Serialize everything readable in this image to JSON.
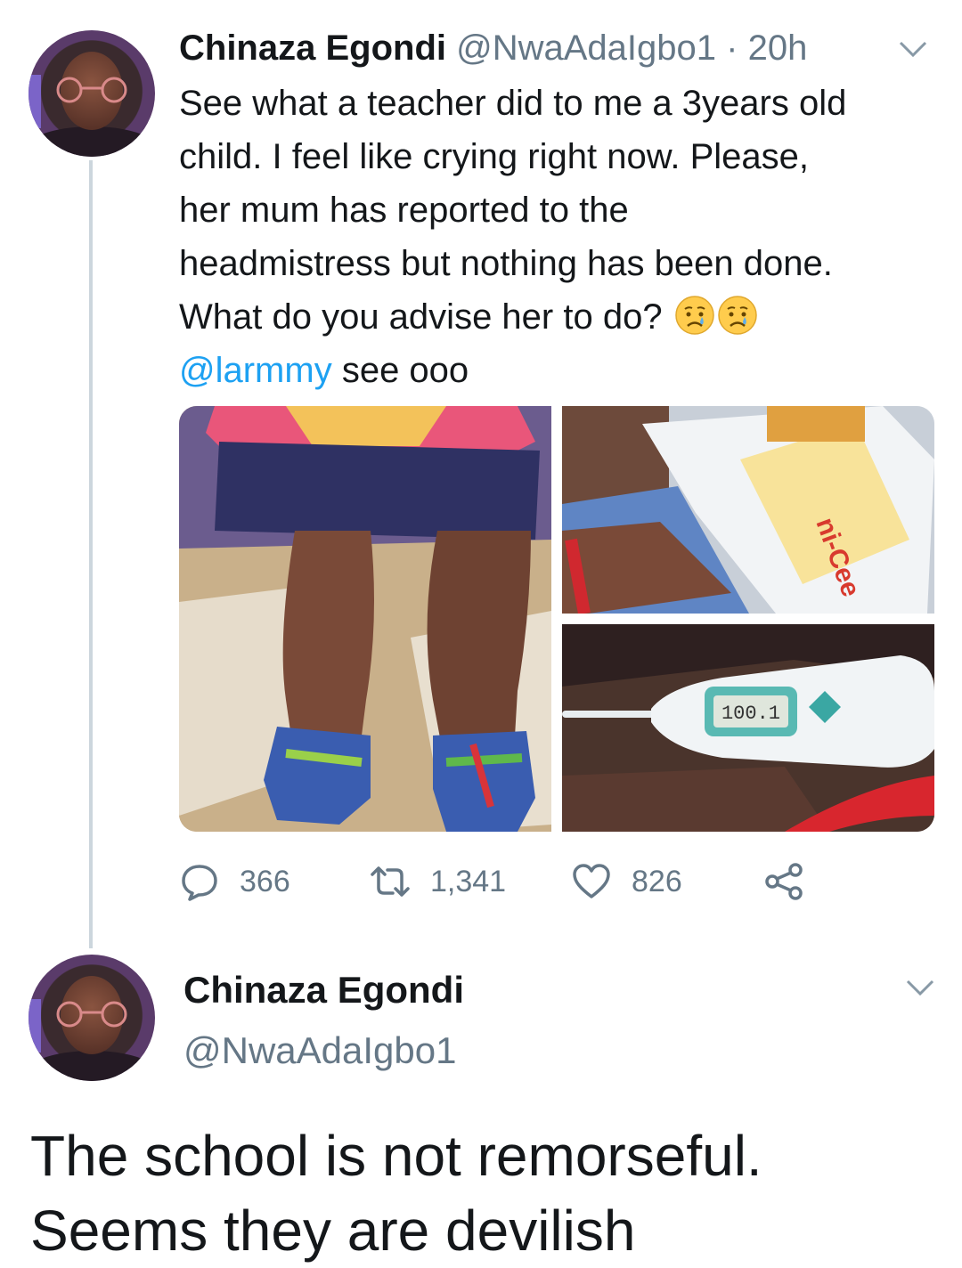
{
  "tweet": {
    "author_name": "Chinaza Egondi",
    "handle": "@NwaAdaIgbo1",
    "separator": "·",
    "time": "20h",
    "body_lines": [
      "See what a teacher did to me a 3years old",
      "child. I feel like crying right now. Please,",
      "her mum has reported to the",
      "headmistress but nothing has been done.",
      "What do you advise her to do?"
    ],
    "mention": "@larmmy",
    "mention_suffix": " see ooo",
    "emojis": [
      "crying-face-emoji",
      "crying-face-emoji"
    ],
    "media": {
      "thermometer_reading": "100.1"
    },
    "actions": {
      "replies": "366",
      "retweets": "1,341",
      "likes": "826"
    },
    "menu_icon": "chevron-down-icon"
  },
  "reply": {
    "author_name": "Chinaza Egondi",
    "handle": "@NwaAdaIgbo1",
    "body_lines": [
      "The school is not remorseful.",
      "Seems they are devilish"
    ],
    "menu_icon": "chevron-down-icon"
  },
  "colors": {
    "text": "#14171a",
    "secondary": "#657786",
    "link": "#1da1f2",
    "thread_line": "#ccd6dd"
  }
}
